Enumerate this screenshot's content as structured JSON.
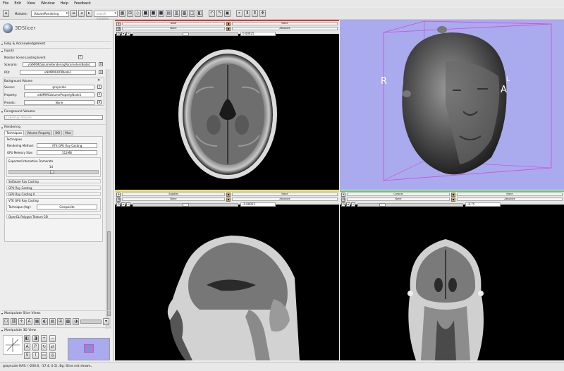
{
  "menu": [
    "File",
    "Edit",
    "View",
    "Window",
    "Help",
    "Feedback"
  ],
  "toolbar": {
    "modules_label": "Modules:",
    "module": "VolumeRendering",
    "search_placeholder": "search modules"
  },
  "left": {
    "app_name": "3DSlicer",
    "help_section": "Help & Acknowledgement",
    "inputs_section": "Inputs",
    "monitor_label": "Monitor Scene Loading Event",
    "scenario_label": "Scenario:",
    "scenario_value": "vtkMRMLVolumeRenderingParametersNode1",
    "roi_label": "ROI:",
    "roi_value": "vtkMRMLROINode1",
    "background_title": "Background Volume",
    "source_label": "Source:",
    "source_value": "grayscale",
    "property_label": "Property:",
    "property_value": "vtkMRMLVolumePropertyNode1",
    "presets_label": "Presets:",
    "presets_value": "None",
    "foreground_section": "Foreground Volume",
    "labelmap_placeholder": "Labelmap Volume",
    "rendering_section": "Rendering",
    "tabs": [
      "Techniques",
      "Volume Property",
      "ROI",
      "Misc"
    ],
    "techniques_title": "Techniques",
    "rendering_method_label": "Rendering Method:",
    "rendering_method_value": "VTK GPU Ray Casting",
    "gpu_memory_label": "GPU Memory Size:",
    "gpu_memory_value": "512MB",
    "framerate_title": "Expected Interactive Framerate",
    "framerate_value": "14",
    "software_rc": "Software Ray Casting",
    "gpu_rc": "GPU Ray Casting",
    "gpu_rc2": "GPU Ray Casting II",
    "vtk_gpu_rc_title": "VTK GPU Ray Casting",
    "technique_label": "Technique (fog):",
    "technique_value": "Composite",
    "opengl_pt": "OpenGL Polygon Texture 3D",
    "manip_slice": "Manipulate Slice Views",
    "manip_3d": "Manipulate 3D View"
  },
  "views": {
    "red": {
      "c1": "Axial",
      "c2": "None",
      "c3": "None",
      "c4": "Absolute",
      "offset": "0.00025"
    },
    "yellow": {
      "c1": "Sagittal",
      "c2": "None",
      "c3": "None",
      "c4": "Absolute",
      "offset": "-0.00025"
    },
    "green": {
      "c1": "Coronal",
      "c2": "None",
      "c3": "None",
      "c4": "Absolute",
      "offset": "-0.75"
    },
    "threeD": {
      "r": "R",
      "a": "A",
      "l": "L"
    }
  },
  "status": "grayscale RAS: (-200.6, -17.4, 0.5), Bg: Slice not shown,",
  "colors": {
    "red": "#e8352b",
    "yellow": "#e7d44b",
    "green": "#6fc36a",
    "lavender": "#aaaaee",
    "box": "#d24ad8"
  }
}
